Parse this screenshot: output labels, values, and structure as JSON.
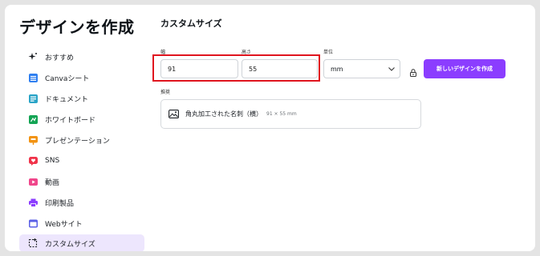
{
  "page_title": "デザインを作成",
  "sidebar": {
    "items": [
      {
        "label": "おすすめ",
        "icon": "sparkle-icon",
        "color": "#1b1f24"
      },
      {
        "label": "Canvaシート",
        "icon": "sheet-icon",
        "color": "#2e7ff0"
      },
      {
        "label": "ドキュメント",
        "icon": "document-icon",
        "color": "#2aa4c7"
      },
      {
        "label": "ホワイトボード",
        "icon": "whiteboard-icon",
        "color": "#13a454"
      },
      {
        "label": "プレゼンテーション",
        "icon": "presentation-icon",
        "color": "#f29312"
      },
      {
        "label": "SNS",
        "icon": "heart-chat-icon",
        "color": "#f0334a"
      },
      {
        "label": "動画",
        "icon": "video-icon",
        "color": "#f0468b"
      },
      {
        "label": "印刷製品",
        "icon": "printer-icon",
        "color": "#8b3dff"
      },
      {
        "label": "Webサイト",
        "icon": "website-icon",
        "color": "#5a5fe6"
      },
      {
        "label": "カスタムサイズ",
        "icon": "custom-size-icon",
        "color": "#1b1f24",
        "active": true
      }
    ]
  },
  "custom_size": {
    "title": "カスタムサイズ",
    "width_label": "幅",
    "width_value": "91",
    "height_label": "高さ",
    "height_value": "55",
    "unit_label": "単位",
    "unit_value": "mm",
    "create_button": "新しいデザインを作成",
    "suggest_label": "推奨",
    "suggestion": {
      "name": "角丸加工された名刺（横）",
      "size": "91 × 55 mm"
    }
  },
  "colors": {
    "accent": "#8b3dff",
    "highlight_border": "#e0141e",
    "active_item_bg": "#ede6fd"
  }
}
